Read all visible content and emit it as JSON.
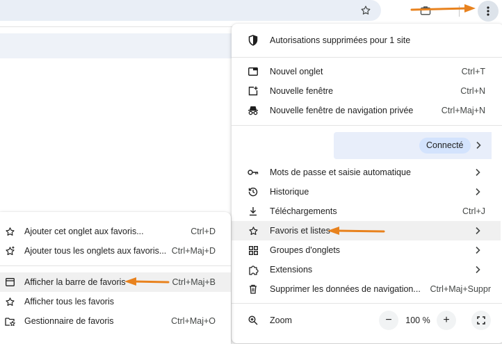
{
  "accent_color": "#e8821e",
  "toolbar": {
    "star_icon": "star-outline-icon",
    "extensions_icon": "briefcase-icon",
    "menu_icon": "three-dots-vertical-icon"
  },
  "menu": {
    "permissions": {
      "label": "Autorisations supprimées pour 1 site",
      "icon": "shield-icon"
    },
    "new_tab": {
      "label": "Nouvel onglet",
      "shortcut": "Ctrl+T",
      "icon": "new-tab-icon"
    },
    "new_window": {
      "label": "Nouvelle fenêtre",
      "shortcut": "Ctrl+N",
      "icon": "new-window-icon"
    },
    "incognito": {
      "label": "Nouvelle fenêtre de navigation privée",
      "shortcut": "Ctrl+Maj+N",
      "icon": "incognito-icon"
    },
    "profile": {
      "status": "Connecté"
    },
    "passwords": {
      "label": "Mots de passe et saisie automatique",
      "icon": "key-icon"
    },
    "history": {
      "label": "Historique",
      "icon": "history-icon"
    },
    "downloads": {
      "label": "Téléchargements",
      "shortcut": "Ctrl+J",
      "icon": "download-icon"
    },
    "bookmarks": {
      "label": "Favoris et listes",
      "icon": "star-icon"
    },
    "tab_groups": {
      "label": "Groupes d'onglets",
      "icon": "grid-icon"
    },
    "extensions": {
      "label": "Extensions",
      "icon": "puzzle-icon"
    },
    "clear_data": {
      "label": "Supprimer les données de navigation...",
      "shortcut": "Ctrl+Maj+Suppr",
      "icon": "trash-icon"
    },
    "zoom": {
      "label": "Zoom",
      "value": "100 %",
      "minus": "−",
      "plus": "+",
      "icon": "zoom-icon"
    }
  },
  "submenu": {
    "bookmark_tab": {
      "label": "Ajouter cet onglet aux favoris...",
      "shortcut": "Ctrl+D",
      "icon": "star-outline-icon"
    },
    "bookmark_all": {
      "label": "Ajouter tous les onglets aux favoris...",
      "shortcut": "Ctrl+Maj+D",
      "icon": "star-add-icon"
    },
    "show_bar": {
      "label": "Afficher la barre de favoris",
      "shortcut": "Ctrl+Maj+B",
      "icon": "bookmark-bar-icon"
    },
    "show_all": {
      "label": "Afficher tous les favoris",
      "icon": "star-outline-icon"
    },
    "manager": {
      "label": "Gestionnaire de favoris",
      "shortcut": "Ctrl+Maj+O",
      "icon": "bookmark-manager-icon"
    }
  }
}
